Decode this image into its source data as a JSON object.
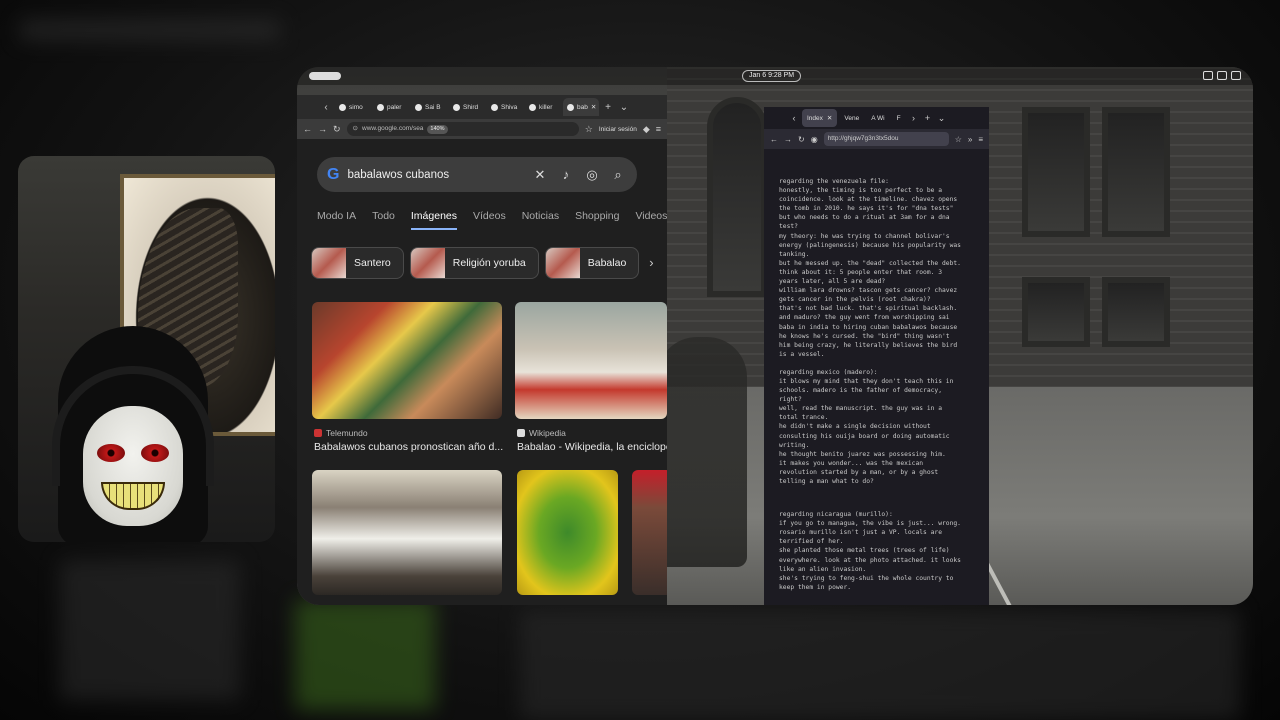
{
  "desktop": {
    "clock": "Jan 6   9:28 PM"
  },
  "chrome": {
    "tabs": [
      {
        "label": "simo"
      },
      {
        "label": "paler"
      },
      {
        "label": "Sai B"
      },
      {
        "label": "Shird"
      },
      {
        "label": "Shiva"
      },
      {
        "label": "killer"
      },
      {
        "label": "bab",
        "active": true
      }
    ],
    "url": "www.google.com/sea",
    "zoom": "140%",
    "signin": "Iniciar sesión",
    "search_query": "babalawos cubanos",
    "filters": [
      "Modo IA",
      "Todo",
      "Imágenes",
      "Vídeos",
      "Noticias",
      "Shopping",
      "Videos"
    ],
    "active_filter": "Imágenes",
    "chips": [
      "Santero",
      "Religión yoruba",
      "Babalao"
    ],
    "results": [
      {
        "source": "Telemundo",
        "caption": "Babalawos cubanos pronostican año d..."
      },
      {
        "source": "Wikipedia",
        "caption": "Babalao - Wikipedia, la enciclope"
      }
    ]
  },
  "tor": {
    "tabs": [
      {
        "label": "Index",
        "active": true
      },
      {
        "label": "Vene"
      },
      {
        "label": "A Wi"
      },
      {
        "label": "F"
      }
    ],
    "url": "http://ghjqw7g3n3tx5dou",
    "paragraphs": [
      [
        "regarding the venezuela file:",
        "honestly, the timing is too perfect to be a",
        "coincidence. look at the timeline. chavez opens",
        "the tomb in 2010. he says it's for \"dna tests\"",
        "but who needs to do a ritual at 3am for a dna",
        "test?",
        "my theory: he was trying to channel bolivar's",
        "energy (palingenesis) because his popularity was",
        "tanking.",
        "but he messed up. the \"dead\" collected the debt.",
        "think about it: 5 people enter that room. 3",
        "years later, all 5 are dead?",
        "william lara drowns? tascon gets cancer? chavez",
        "gets cancer in the pelvis (root chakra)?",
        "that's not bad luck. that's spiritual backlash.",
        "and maduro? the guy went from worshipping sai",
        "baba in india to hiring cuban babalawos because",
        "he knows he's cursed. the \"bird\" thing wasn't",
        "him being crazy, he literally believes the bird",
        "is a vessel."
      ],
      [
        "regarding mexico (madero):",
        "it blows my mind that they don't teach this in",
        "schools. madero is the father of democracy,",
        "right?",
        "well, read the manuscript. the guy was in a",
        "total trance.",
        "he didn't make a single decision without",
        "consulting his ouija board or doing automatic",
        "writing.",
        "he thought benito juarez was possessing him.",
        "it makes you wonder... was the mexican",
        "revolution started by a man, or by a ghost",
        "telling a man what to do?"
      ],
      [
        "regarding nicaragua (murillo):",
        "if you go to managua, the vibe is just... wrong.",
        "rosario murillo isn't just a VP. locals are",
        "terrified of her.",
        "she planted those metal trees (trees of life)",
        "everywhere. look at the photo attached. it looks",
        "like an alien invasion.",
        "she's trying to feng-shui the whole country to",
        "keep them in power."
      ]
    ]
  }
}
